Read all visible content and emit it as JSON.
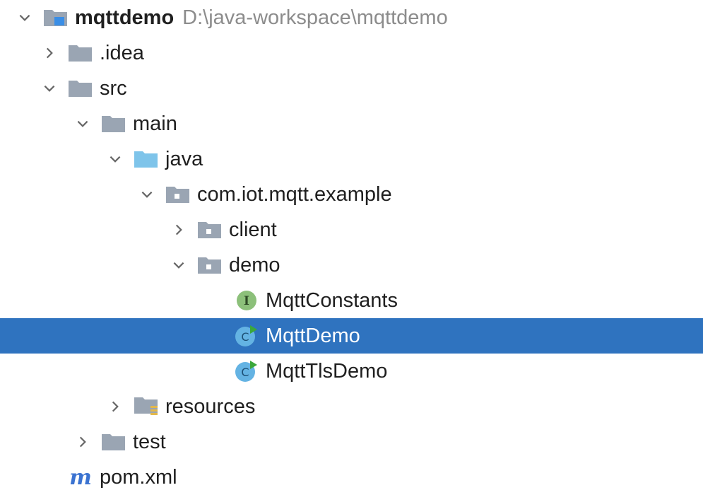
{
  "project_tree": {
    "root": {
      "label": "mqttdemo",
      "path": "D:\\java-workspace\\mqttdemo",
      "expanded": true,
      "icon": "project-folder-icon"
    },
    "nodes": [
      {
        "label": ".idea",
        "expanded": false,
        "icon": "folder-icon"
      },
      {
        "label": "src",
        "expanded": true,
        "icon": "folder-icon"
      },
      {
        "label": "main",
        "expanded": true,
        "icon": "folder-icon"
      },
      {
        "label": "java",
        "expanded": true,
        "icon": "source-folder-icon"
      },
      {
        "label": "com.iot.mqtt.example",
        "expanded": true,
        "icon": "package-icon"
      },
      {
        "label": "client",
        "expanded": false,
        "icon": "package-icon"
      },
      {
        "label": "demo",
        "expanded": true,
        "icon": "package-icon"
      },
      {
        "label": "MqttConstants",
        "icon": "interface-icon",
        "badge": "I"
      },
      {
        "label": "MqttDemo",
        "icon": "runnable-class-icon",
        "badge": "C",
        "selected": true
      },
      {
        "label": "MqttTlsDemo",
        "icon": "runnable-class-icon",
        "badge": "C"
      },
      {
        "label": "resources",
        "expanded": false,
        "icon": "resources-folder-icon"
      },
      {
        "label": "test",
        "expanded": false,
        "icon": "folder-icon"
      },
      {
        "label": "pom.xml",
        "icon": "maven-icon",
        "badge": "m"
      }
    ]
  },
  "colors": {
    "selection": "#2f73bf",
    "folder": "#9aa5b3",
    "source_folder": "#7ec4ea",
    "interface_badge": "#8cc07a",
    "class_badge": "#64b3e3",
    "run_arrow": "#3ba73b",
    "maven": "#3b73d1"
  }
}
